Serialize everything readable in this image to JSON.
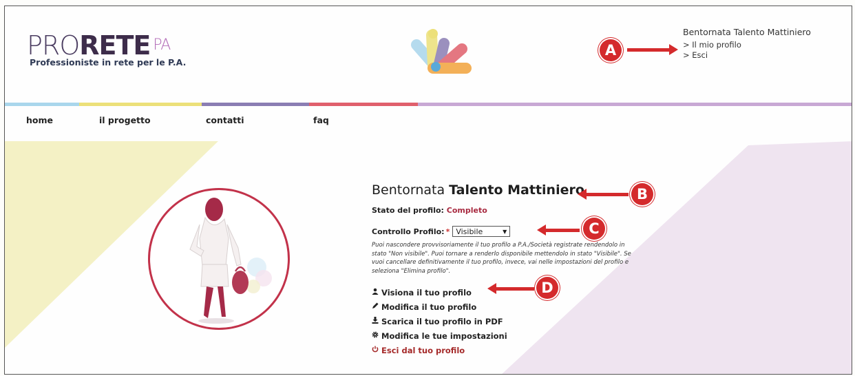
{
  "header": {
    "logo_main": "PRO",
    "logo_bold": "RETE",
    "logo_sup": "PA",
    "tagline": "Professioniste in rete per le P.A.",
    "user_greeting": "Bentornata Talento Mattiniero",
    "profile_link": "> Il mio profilo",
    "logout_link": "> Esci"
  },
  "nav": {
    "items": [
      "home",
      "il progetto",
      "contatti",
      "faq"
    ]
  },
  "annotations": [
    "A",
    "B",
    "C",
    "D"
  ],
  "colors": {
    "accent": "#a82a40",
    "annotation": "#d42a2c",
    "bar": [
      "#a9d6ec",
      "#ece079",
      "#8a7db3",
      "#e0606c",
      "#c8a8d4"
    ]
  },
  "profile": {
    "title_prefix": "Bentornata ",
    "title_name": "Talento Mattiniero",
    "status_label": "Stato del profilo: ",
    "status_value": "Completo",
    "control_label": "Controllo Profilo:",
    "control_required": "*",
    "control_value": "Visibile",
    "help_text": "Puoi nascondere provvisoriamente il tuo profilo a P.A./Società registrate rendendolo in stato \"Non visibile\". Puoi tornare a renderlo disponibile mettendolo in stato \"Visibile\". Se vuoi cancellare definitivamente il tuo profilo, invece, vai nelle impostazioni del profilo e seleziona \"Elimina profilo\"."
  },
  "actions": [
    {
      "icon": "user-icon",
      "label": "Visiona il tuo profilo"
    },
    {
      "icon": "pencil-icon",
      "label": "Modifica il tuo profilo"
    },
    {
      "icon": "download-icon",
      "label": "Scarica il tuo profilo in PDF"
    },
    {
      "icon": "gear-icon",
      "label": "Modifica le tue impostazioni"
    },
    {
      "icon": "power-icon",
      "label": "Esci dal tuo profilo"
    }
  ]
}
